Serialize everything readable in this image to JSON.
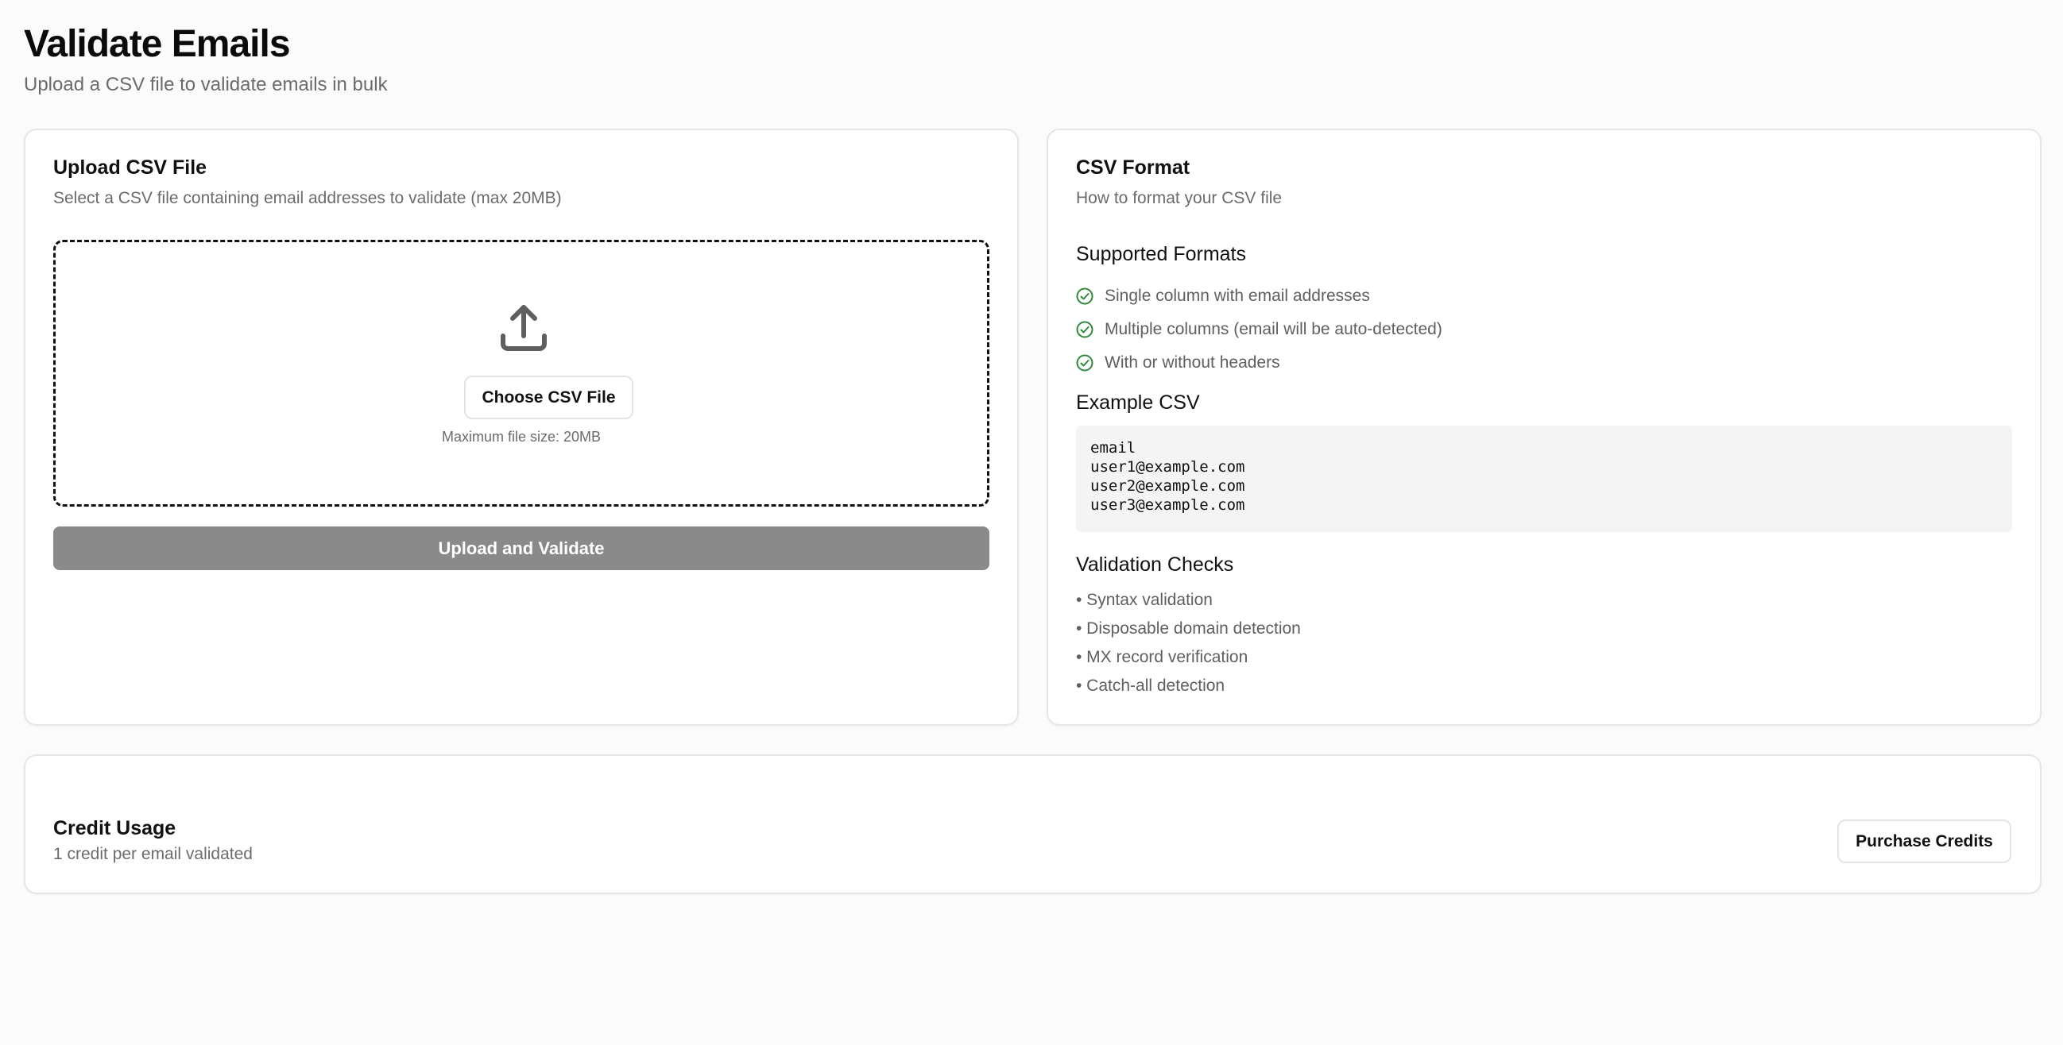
{
  "page": {
    "title": "Validate Emails",
    "subtitle": "Upload a CSV file to validate emails in bulk"
  },
  "upload_card": {
    "title": "Upload CSV File",
    "description": "Select a CSV file containing email addresses to validate (max 20MB)",
    "dropzone": {
      "icon": "upload-icon",
      "choose_button_label": "Choose CSV File",
      "max_size_text": "Maximum file size: 20MB"
    },
    "submit_button_label": "Upload and Validate"
  },
  "format_card": {
    "title": "CSV Format",
    "description": "How to format your CSV file",
    "supported_formats": {
      "heading": "Supported Formats",
      "items": [
        "Single column with email addresses",
        "Multiple columns (email will be auto-detected)",
        "With or without headers"
      ]
    },
    "example": {
      "heading": "Example CSV",
      "lines": [
        "email",
        "user1@example.com",
        "user2@example.com",
        "user3@example.com"
      ]
    },
    "validation_checks": {
      "heading": "Validation Checks",
      "items": [
        "• Syntax validation",
        "• Disposable domain detection",
        "• MX record verification",
        "• Catch-all detection"
      ]
    }
  },
  "credit_card": {
    "title": "Credit Usage",
    "description": "1 credit per email validated",
    "purchase_button_label": "Purchase Credits"
  },
  "colors": {
    "background": "#fbfbfb",
    "check_green": "#2f8a3b",
    "disabled_button": "#8a8a8a",
    "muted_text": "#6b6b6b"
  }
}
